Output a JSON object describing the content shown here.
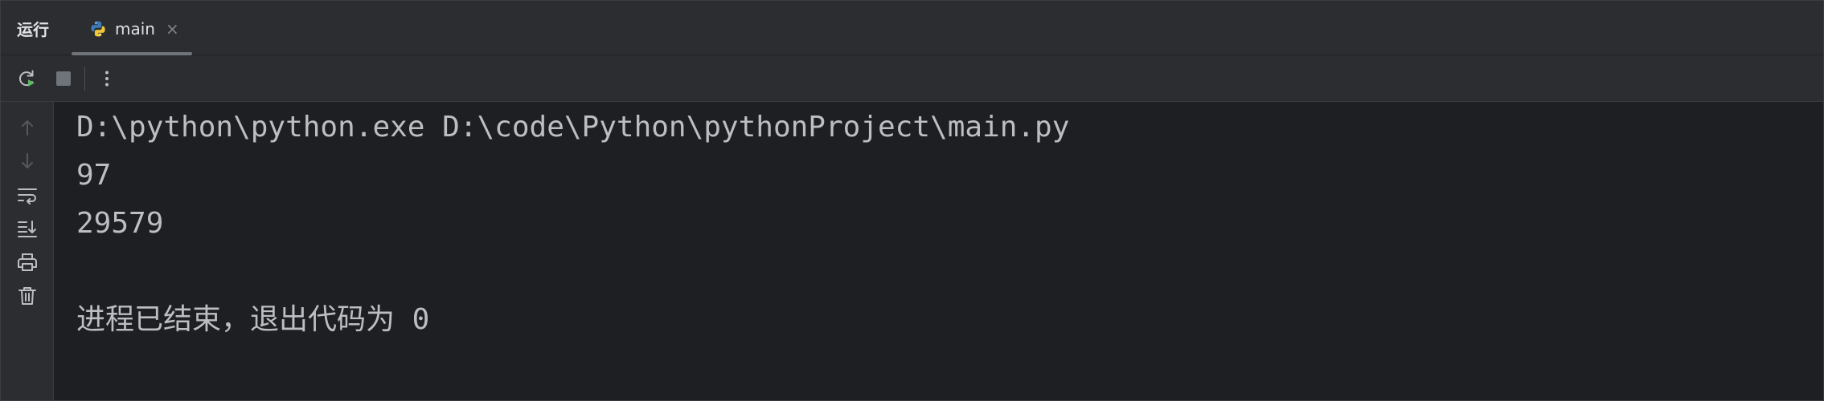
{
  "window": {
    "title": "运行"
  },
  "tab": {
    "label": "main",
    "close_glyph": "×",
    "icon": "python-icon"
  },
  "toolbar": {
    "rerun_icon": "rerun-icon",
    "stop_icon": "stop-icon",
    "more_icon": "more-vertical-icon"
  },
  "gutter": {
    "icons": [
      "arrow-up-icon",
      "arrow-down-icon",
      "soft-wrap-icon",
      "scroll-to-end-icon",
      "print-icon",
      "trash-icon"
    ]
  },
  "console": {
    "lines": [
      "D:\\python\\python.exe D:\\code\\Python\\pythonProject\\main.py",
      "97",
      "29579",
      "",
      "进程已结束，退出代码为 0"
    ]
  },
  "colors": {
    "background": "#1e1f22",
    "panel": "#2b2d30",
    "text": "#bcbec4",
    "rerun_accent": "#5fb865",
    "python_blue": "#3d7ab8",
    "python_yellow": "#f0c73a"
  }
}
